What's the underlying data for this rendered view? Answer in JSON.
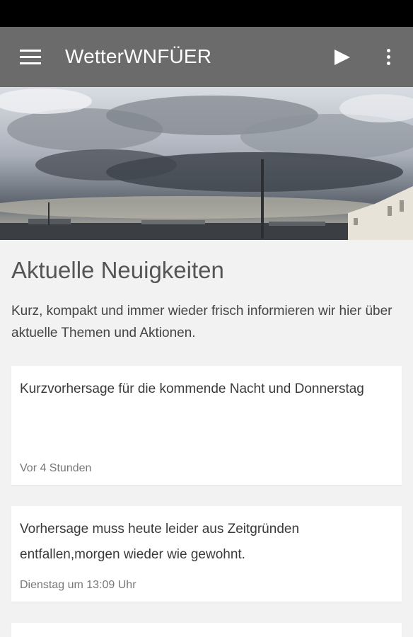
{
  "app": {
    "title": "WetterWNFÜER"
  },
  "toolbar": {
    "menu_icon": "hamburger-menu-icon",
    "play_icon": "play-icon",
    "more_icon": "more-vert-icon"
  },
  "section": {
    "title": "Aktuelle Neuigkeiten",
    "description": "Kurz, kompakt und immer wieder frisch informieren wir hier über aktuelle Themen und Aktionen."
  },
  "news": [
    {
      "title": "Kurzvorhersage für die kommende Nacht und Donnerstag",
      "time": "Vor 4 Stunden"
    },
    {
      "title": "Vorhersage muss heute leider aus Zeitgründen entfallen,morgen wieder wie gewohnt.",
      "time": "Dienstag um 13:09 Uhr"
    }
  ]
}
